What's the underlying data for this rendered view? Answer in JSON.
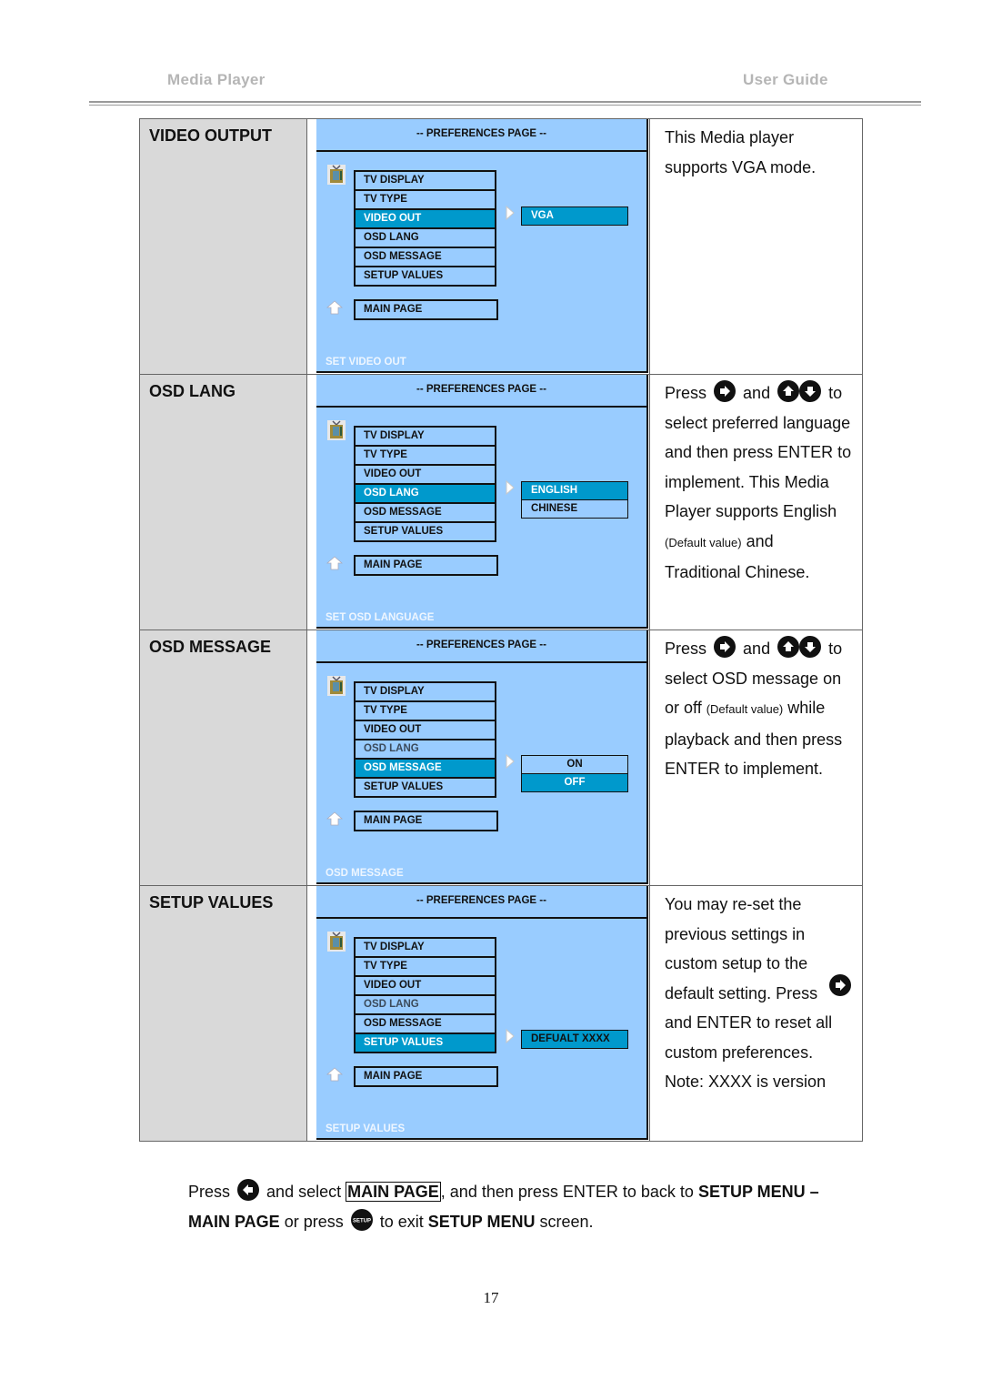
{
  "header": {
    "left": "Media  Player",
    "right": "User  Guide"
  },
  "rows": [
    {
      "label": "VIDEO OUTPUT",
      "screen": {
        "title": "-- PREFERENCES PAGE --",
        "menu": [
          "TV DISPLAY",
          "TV TYPE",
          "VIDEO OUT",
          "OSD LANG",
          "OSD MESSAGE",
          "SETUP VALUES"
        ],
        "selected_index": 2,
        "main_page": "MAIN PAGE",
        "options": [
          {
            "label": "VGA",
            "selected": true
          }
        ],
        "status": "SET VIDEO OUT"
      },
      "description": {
        "lines": [
          "This Media player",
          "supports VGA mode."
        ]
      }
    },
    {
      "label": "OSD LANG",
      "screen": {
        "title": "-- PREFERENCES PAGE --",
        "menu": [
          "TV DISPLAY",
          "TV TYPE",
          "VIDEO OUT",
          "OSD LANG",
          "OSD MESSAGE",
          "SETUP VALUES"
        ],
        "selected_index": 3,
        "main_page": "MAIN PAGE",
        "options": [
          {
            "label": "ENGLISH",
            "selected": true
          },
          {
            "label": "CHINESE",
            "selected": false
          }
        ],
        "status": "SET OSD LANGUAGE"
      },
      "description": {
        "press": "Press",
        "and": "and",
        "to": "to",
        "lines": [
          "select preferred language",
          "and then press ENTER to",
          "implement. This Media",
          "Player supports English"
        ],
        "default_note": "(Default value)",
        "and_word": "and",
        "last_line": "Traditional Chinese."
      }
    },
    {
      "label": "OSD MESSAGE",
      "screen": {
        "title": "-- PREFERENCES PAGE --",
        "menu": [
          "TV DISPLAY",
          "TV TYPE",
          "VIDEO OUT",
          "OSD LANG",
          "OSD MESSAGE",
          "SETUP VALUES"
        ],
        "selected_index": 4,
        "main_page": "MAIN PAGE",
        "options": [
          {
            "label": "ON",
            "selected": false
          },
          {
            "label": "OFF",
            "selected": true
          }
        ],
        "status": "OSD MESSAGE"
      },
      "description": {
        "press": "Press",
        "and": "and",
        "to": "to",
        "line1": "select OSD message on",
        "or_off": "or off",
        "default_note": "(Default value)",
        "while": "while",
        "line3": "playback and then press",
        "line4": "ENTER to implement."
      }
    },
    {
      "label": "SETUP VALUES",
      "screen": {
        "title": "-- PREFERENCES PAGE --",
        "menu": [
          "TV DISPLAY",
          "TV TYPE",
          "VIDEO OUT",
          "OSD LANG",
          "OSD MESSAGE",
          "SETUP VALUES"
        ],
        "selected_index": 5,
        "main_page": "MAIN PAGE",
        "options": [
          {
            "label": "DEFUALT XXXX",
            "selected": true
          }
        ],
        "status": "SETUP VALUES"
      },
      "description": {
        "lines": [
          "You may re-set the",
          "previous settings in",
          "custom setup to the",
          "default setting. Press",
          "and ENTER to reset all",
          "custom preferences.",
          "Note: XXXX is version"
        ]
      }
    }
  ],
  "footer": {
    "press": "Press",
    "and_select": "and select",
    "main_page_boxed": "MAIN PAGE",
    "then_back": ", and then press ENTER to back to",
    "setup_menu_dash": "SETUP MENU –",
    "main_page": "MAIN PAGE",
    "or_press": "or press",
    "setup_button_label": "SETUP",
    "to_exit": "to exit",
    "setup_menu": "SETUP MENU",
    "screen": "screen."
  },
  "page_number": "17",
  "icons": {
    "right": "right-arrow-button-icon",
    "up": "up-arrow-button-icon",
    "down": "down-arrow-button-icon",
    "left": "left-arrow-button-icon",
    "setup": "setup-button-icon",
    "tv": "tv-icon",
    "home": "home-arrow-icon"
  },
  "colors": {
    "screen_bg": "#99ccff",
    "highlight": "#0099cc",
    "label_bg": "#d9d9d9",
    "header_text": "#b5b5b5"
  }
}
